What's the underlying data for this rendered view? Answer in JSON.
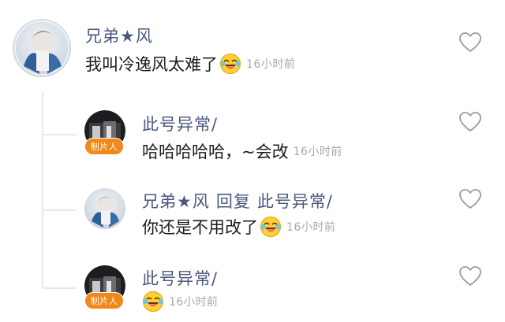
{
  "comments": [
    {
      "username": "兄弟★风",
      "text": "我叫冷逸风太难了",
      "emoji": "laughing-crying-emoji",
      "time": "16小时前"
    },
    {
      "username": "此号异常/",
      "badge": "制片人",
      "text": "哈哈哈哈哈，~会改",
      "time": "16小时前"
    },
    {
      "username": "兄弟★风",
      "reply_word": "回复",
      "reply_to": "此号异常/",
      "text": "你还是不用改了",
      "emoji": "laughing-crying-emoji",
      "time": "16小时前"
    },
    {
      "username": "此号异常/",
      "badge": "制片人",
      "text": "",
      "emoji": "laughing-crying-emoji",
      "time": "16小时前"
    }
  ],
  "icons": {
    "like": "heart-outline-icon"
  },
  "colors": {
    "username": "#4a587f",
    "text": "#1c1c1f",
    "time": "#a8a8b0",
    "badge": "#f2871a",
    "thread_line": "#e8e8ec"
  }
}
